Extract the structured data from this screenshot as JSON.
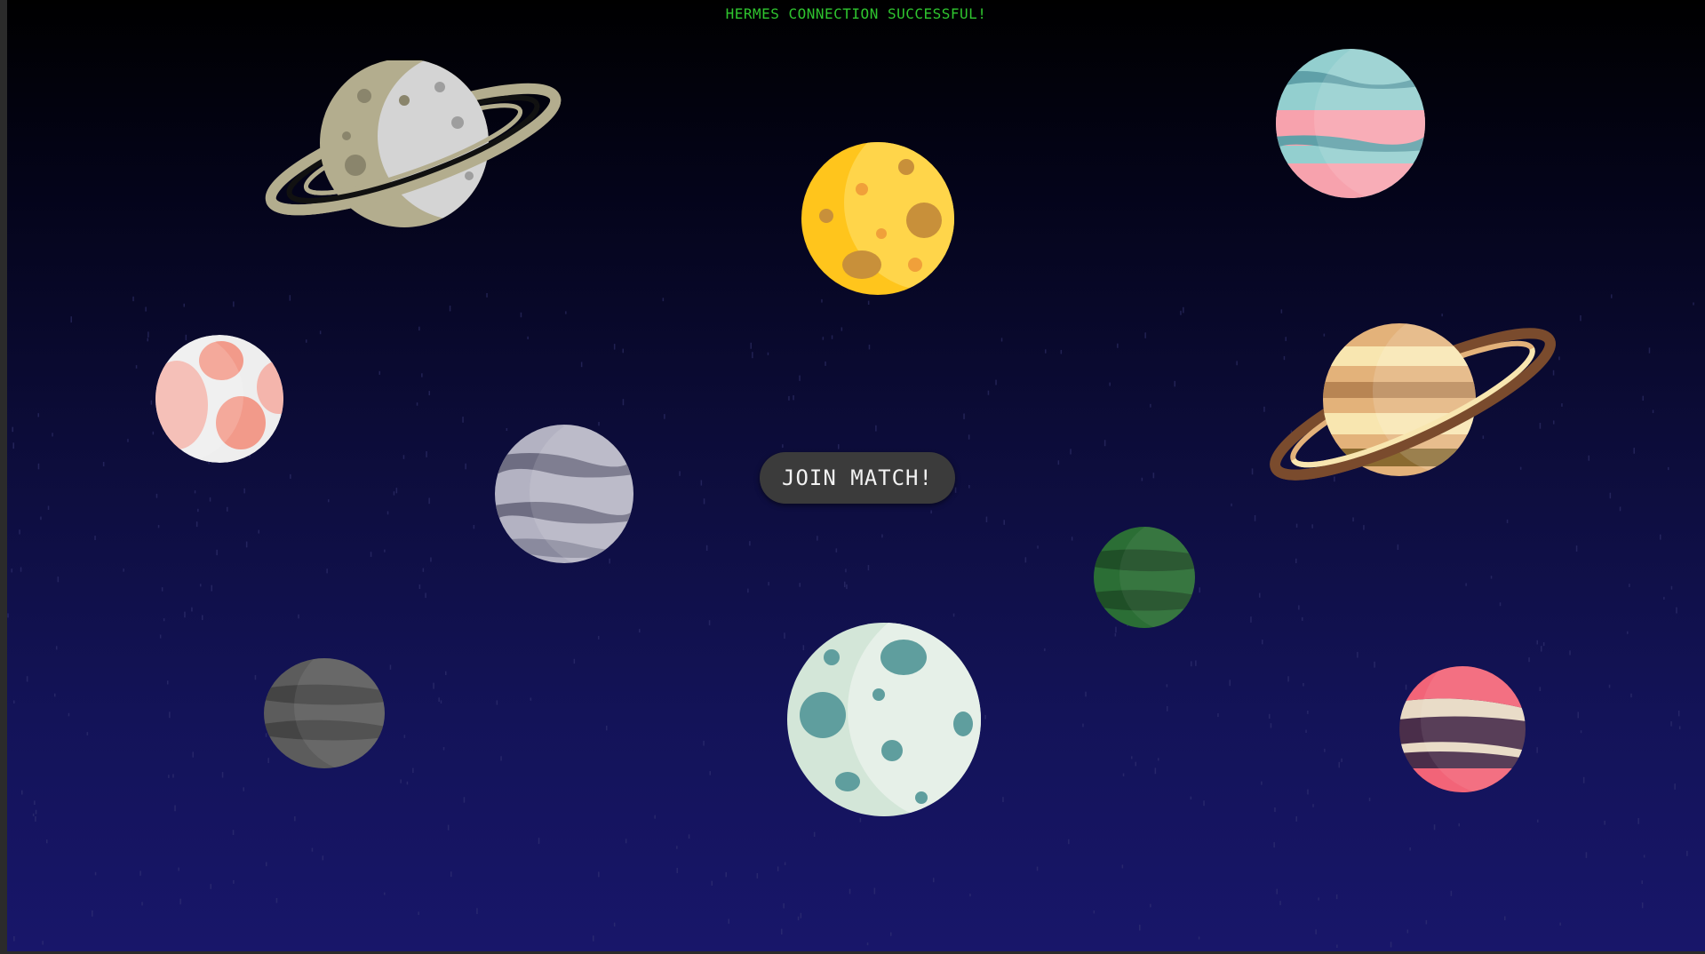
{
  "status": {
    "message": "HERMES CONNECTION SUCCESSFUL!",
    "color": "#2fc52f"
  },
  "join_button": {
    "label": "JOIN MATCH!"
  },
  "background": {
    "top_color": "#000000",
    "bottom_color": "#18166a"
  },
  "planets": [
    {
      "name": "grey-ringed-planet",
      "colors": [
        "#b3ad8e",
        "#d4d4d4",
        "#8a856c"
      ]
    },
    {
      "name": "yellow-moon",
      "colors": [
        "#ffc51c",
        "#ffd54a",
        "#c8903a"
      ]
    },
    {
      "name": "teal-pink-planet",
      "colors": [
        "#93cfcf",
        "#f7a2ad",
        "#5fa0a8"
      ]
    },
    {
      "name": "white-red-planet",
      "colors": [
        "#eeeeee",
        "#f29a8a"
      ]
    },
    {
      "name": "purple-grey-planet",
      "colors": [
        "#b3b2c2",
        "#6e6d82"
      ]
    },
    {
      "name": "orange-ringed-planet",
      "colors": [
        "#e3b27a",
        "#f8e6b0",
        "#7a4b2d"
      ]
    },
    {
      "name": "green-planet",
      "colors": [
        "#2b6e35",
        "#1f4f27"
      ]
    },
    {
      "name": "dark-grey-planet",
      "colors": [
        "#5c5c5c",
        "#444444"
      ]
    },
    {
      "name": "pale-green-moon",
      "colors": [
        "#d3e6d8",
        "#5f9e9e"
      ]
    },
    {
      "name": "red-striped-planet",
      "colors": [
        "#f26478",
        "#e8d9c4",
        "#4a2e4a"
      ]
    }
  ]
}
